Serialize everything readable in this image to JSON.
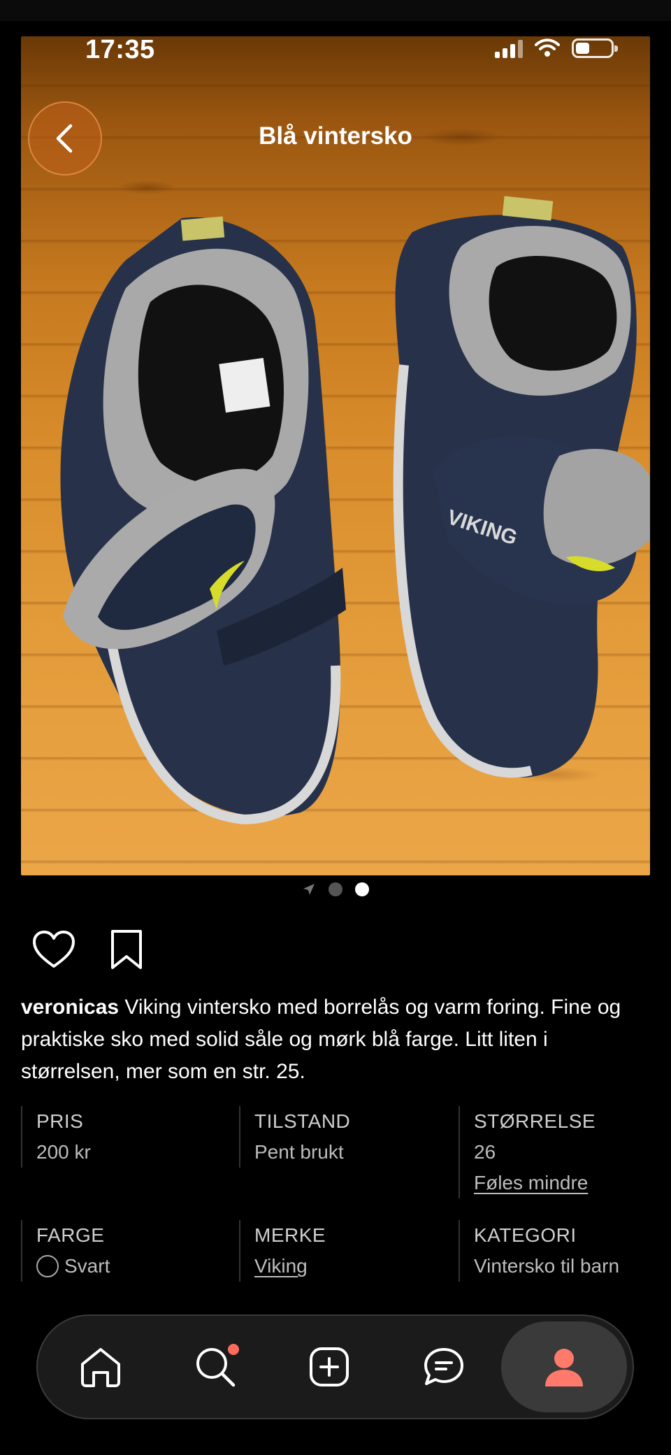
{
  "status": {
    "time": "17:35"
  },
  "header": {
    "title": "Blå vintersko"
  },
  "carousel": {
    "count": 3,
    "active_index": 2
  },
  "listing": {
    "username": "veronicas",
    "description": " Viking vintersko med borrelås og varm foring. Fine og praktiske sko med solid såle og mørk blå farge. Litt liten i størrelsen, mer som en str. 25."
  },
  "details": {
    "price_label": "PRIS",
    "price_value": "200 kr",
    "condition_label": "TILSTAND",
    "condition_value": "Pent brukt",
    "size_label": "STØRRELSE",
    "size_value": "26",
    "size_note": "Føles mindre",
    "color_label": "FARGE",
    "color_value": "Svart",
    "brand_label": "MERKE",
    "brand_value": "Viking",
    "category_label": "KATEGORI",
    "category_value": "Vintersko til barn"
  },
  "tabbar": {
    "items": [
      "home-icon",
      "search-icon",
      "add-icon",
      "messages-icon",
      "profile-icon"
    ],
    "active": "profile",
    "accent": "#ff7a6b"
  },
  "colors": {
    "background": "#000000",
    "accent": "#ff7a6b"
  }
}
